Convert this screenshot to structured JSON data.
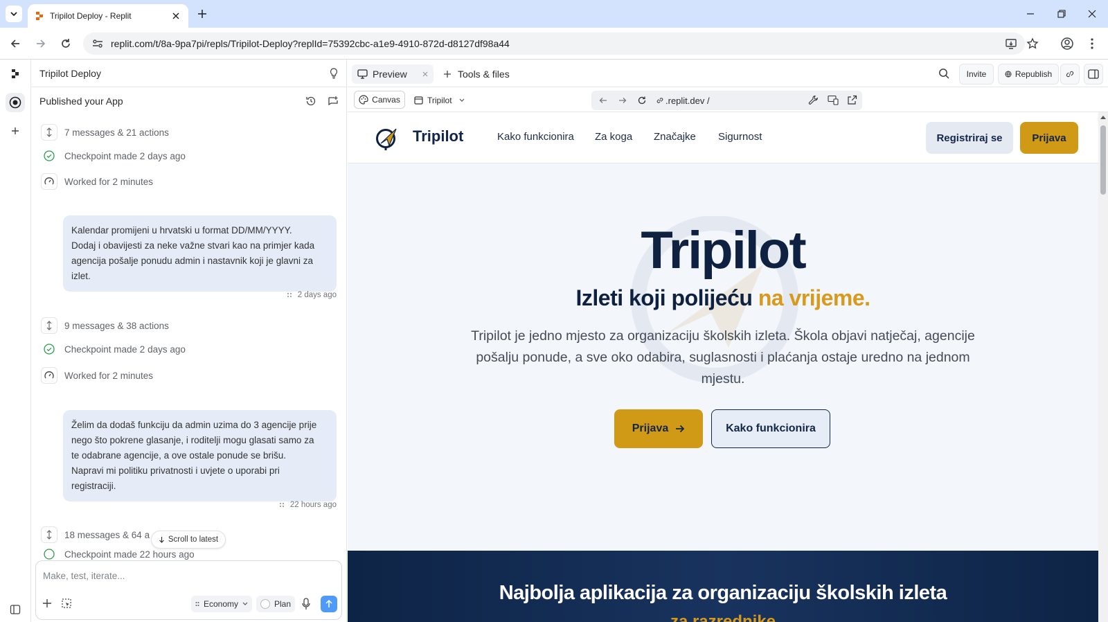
{
  "browser": {
    "tab_title": "Tripilot Deploy - Replit",
    "url": "replit.com/t/8a-9pa7pi/repls/Tripilot-Deploy?replId=75392cbc-a1e9-4910-872d-d8127df98a44"
  },
  "agent": {
    "project_title": "Tripilot Deploy",
    "status": "Published your App",
    "items": [
      {
        "type": "summary",
        "text": "7 messages & 21 actions"
      },
      {
        "type": "checkpoint",
        "text": "Checkpoint made 2 days ago"
      },
      {
        "type": "worked",
        "text": "Worked for 2 minutes"
      },
      {
        "type": "message",
        "lines": [
          "Kalendar promijeni u hrvatski u format DD/MM/YYYY.",
          "Dodaj i obavijesti za neke važne stvari kao na primjer kada",
          "agencija pošalje ponudu admin i nastavnik koji je glavni za",
          "izlet."
        ],
        "time": "2 days ago"
      },
      {
        "type": "summary",
        "text": "9 messages & 38 actions"
      },
      {
        "type": "checkpoint",
        "text": "Checkpoint made 2 days ago"
      },
      {
        "type": "worked",
        "text": "Worked for 2 minutes"
      },
      {
        "type": "message",
        "lines": [
          "Želim da dodaš funkciju da admin uzima do 3 agencije prije",
          "nego što pokrene glasanje, i roditelji mogu glasati samo za",
          "te odabrane agencije, a ove ostale ponude se brišu.",
          "Napravi mi politiku privatnosti i uvjete o uporabi pri",
          "registraciji."
        ],
        "time": "22 hours ago"
      },
      {
        "type": "summary",
        "text": "18 messages & 64 a"
      },
      {
        "type": "checkpoint",
        "text": "Checkpoint made 22 hours ago"
      }
    ],
    "scroll_latest": "Scroll to latest",
    "input_placeholder": "Make, test, iterate...",
    "mode": "Economy",
    "plan": "Plan"
  },
  "workspace": {
    "tab_preview": "Preview",
    "tab_tools": "Tools & files",
    "invite": "Invite",
    "republish": "Republish",
    "canvas": "Canvas",
    "app_select": "Tripilot",
    "preview_url": ".replit.dev /"
  },
  "site": {
    "brand": "Tripilot",
    "nav": [
      "Kako funkcionira",
      "Za koga",
      "Značajke",
      "Sigurnost"
    ],
    "register": "Registriraj se",
    "login": "Prijava",
    "hero_title": "Tripilot",
    "hero_sub_main": "Izleti koji polijeću ",
    "hero_sub_accent": "na vrijeme.",
    "hero_desc": "Tripilot je jedno mjesto za organizaciju školskih izleta. Škola objavi natječaj, agencije pošalju ponude, a sve oko odabira, suglasnosti i plaćanja ostaje uredno na jednom mjestu.",
    "cta_primary": "Prijava",
    "cta_secondary": "Kako funkcionira",
    "band_title": "Najbolja aplikacija za organizaciju školskih izleta",
    "band_sub": "za razrednike"
  },
  "colors": {
    "accent_gold": "#d19a16",
    "navy": "#0f2140",
    "bubble": "#e5ebf7"
  }
}
